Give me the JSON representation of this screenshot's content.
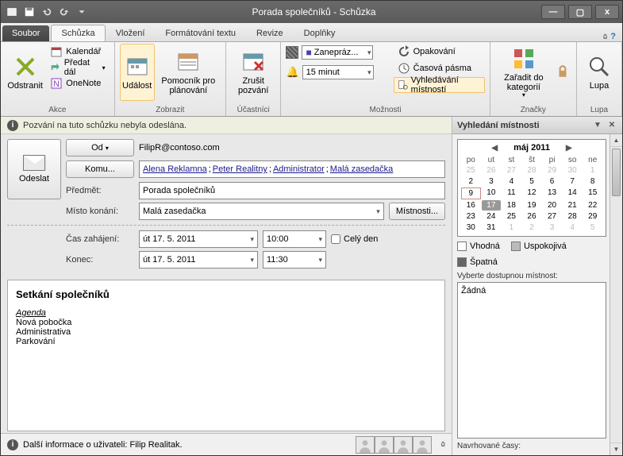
{
  "window": {
    "title": "Porada společníků  -  Schůzka"
  },
  "tabs": {
    "file": "Soubor",
    "items": [
      "Schůzka",
      "Vložení",
      "Formátování textu",
      "Revize",
      "Doplňky"
    ],
    "active": 0
  },
  "ribbon": {
    "groups": {
      "akce": {
        "label": "Akce",
        "delete": "Odstranit",
        "calendar": "Kalendář",
        "forward": "Předat dál",
        "onenote": "OneNote"
      },
      "zobrazit": {
        "label": "Zobrazit",
        "event": "Událost",
        "scheduling": "Pomocník pro plánování"
      },
      "ucastnici": {
        "label": "Účastníci",
        "cancel": "Zrušit pozvání"
      },
      "moznosti": {
        "label": "Možnosti",
        "status_icon": "■",
        "status": "Zanepráz...",
        "reminder_icon": "⏰",
        "reminder": "15 minut",
        "recurrence": "Opakování",
        "timezones": "Časová pásma",
        "roomfinder": "Vyhledávání místností"
      },
      "znacky": {
        "label": "Značky",
        "categorize": "Zařadit do kategorií"
      },
      "lupa": {
        "label": "Lupa",
        "zoom": "Lupa"
      }
    }
  },
  "info_bar": "Pozvání na tuto schůzku nebyla odeslána.",
  "form": {
    "send": "Odeslat",
    "from_btn": "Od",
    "from_val": "FilipR@contoso.com",
    "to_btn": "Komu...",
    "attendees": [
      "Alena Reklamna",
      "Peter Realitny",
      "Administrator",
      "Malá zasedačka"
    ],
    "subject_label": "Předmět:",
    "subject": "Porada společníků",
    "location_label": "Místo konání:",
    "location": "Malá zasedačka",
    "rooms_btn": "Místnosti...",
    "start_label": "Čas zahájení:",
    "start_date": "út 17. 5. 2011",
    "start_time": "10:00",
    "allday": "Celý den",
    "end_label": "Konec:",
    "end_date": "út 17. 5. 2011",
    "end_time": "11:30"
  },
  "body": {
    "heading": "Setkání společníků",
    "agenda_label": "Agenda",
    "lines": [
      "Nová pobočka",
      "Administrativa",
      "Parkování"
    ]
  },
  "people_strip": "Další informace o uživateli: Filip Realitak.",
  "roomfinder": {
    "title": "Vyhledání místnosti",
    "month": "máj 2011",
    "dow": [
      "po",
      "ut",
      "st",
      "št",
      "pi",
      "so",
      "ne"
    ],
    "leading_out": [
      25,
      26,
      27,
      28,
      29,
      30,
      1
    ],
    "days": [
      2,
      3,
      4,
      5,
      6,
      7,
      8,
      9,
      10,
      11,
      12,
      13,
      14,
      15,
      16,
      17,
      18,
      19,
      20,
      21,
      22,
      23,
      24,
      25,
      26,
      27,
      28,
      29,
      30,
      31
    ],
    "trailing_out": [
      1,
      2,
      3,
      4,
      5
    ],
    "selected_day": 17,
    "today": 9,
    "legend": {
      "good": "Vhodná",
      "fair": "Uspokojivá",
      "bad": "Špatná"
    },
    "avail_label": "Vyberte dostupnou místnost:",
    "avail_none": "Žádná",
    "suggest_label": "Navrhované časy:"
  }
}
